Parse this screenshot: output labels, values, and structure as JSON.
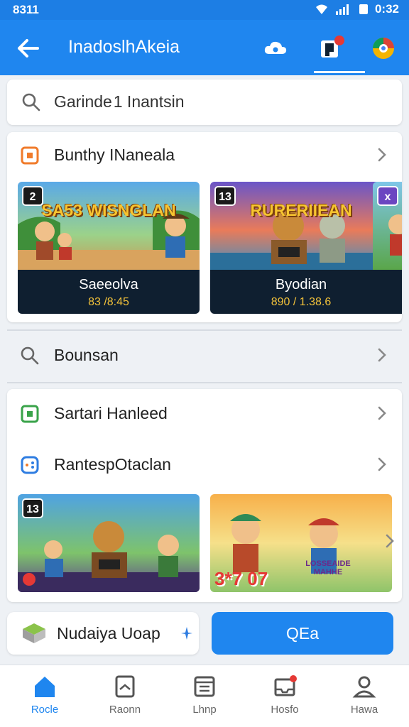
{
  "status": {
    "time_left": "8311",
    "time_right": "0:32"
  },
  "header": {
    "title": "InadoslhAkeia"
  },
  "search": {
    "placeholder": "Garinde 1 Inantsin"
  },
  "section1": {
    "label": "Bunthy INaneala",
    "items": [
      {
        "badge": "2",
        "art_title": "SA53 WISNGLAN",
        "title": "Saeeolva",
        "subtitle": "83 /8:45"
      },
      {
        "badge": "13",
        "art_title": "RURERIIEAN",
        "title": "Byodian",
        "subtitle": "890 / 1.38.6"
      },
      {
        "badge": "x",
        "art_title": "",
        "title": "",
        "subtitle": ""
      }
    ]
  },
  "row2": {
    "label": "Bounsan"
  },
  "section2": {
    "row_a": "Sartari Hanleed",
    "row_b": "RantespOtaclan",
    "items": [
      {
        "badge": "13",
        "art_title": ""
      },
      {
        "badge": "",
        "art_title": "3*7 07"
      }
    ],
    "side_badge": "LOSSEAIDE MAHHE"
  },
  "bottom": {
    "left_label": "Nudaiya Uoap",
    "right_label": "QEa"
  },
  "nav": [
    {
      "label": "Rocle"
    },
    {
      "label": "Raonn"
    },
    {
      "label": "Lhnp"
    },
    {
      "label": "Hosfo"
    },
    {
      "label": "Hawa"
    }
  ],
  "colors": {
    "primary": "#1f86ef",
    "status_bar": "#1d7ee4",
    "accent_orange": "#f07b2b",
    "accent_green": "#3aa34a"
  }
}
